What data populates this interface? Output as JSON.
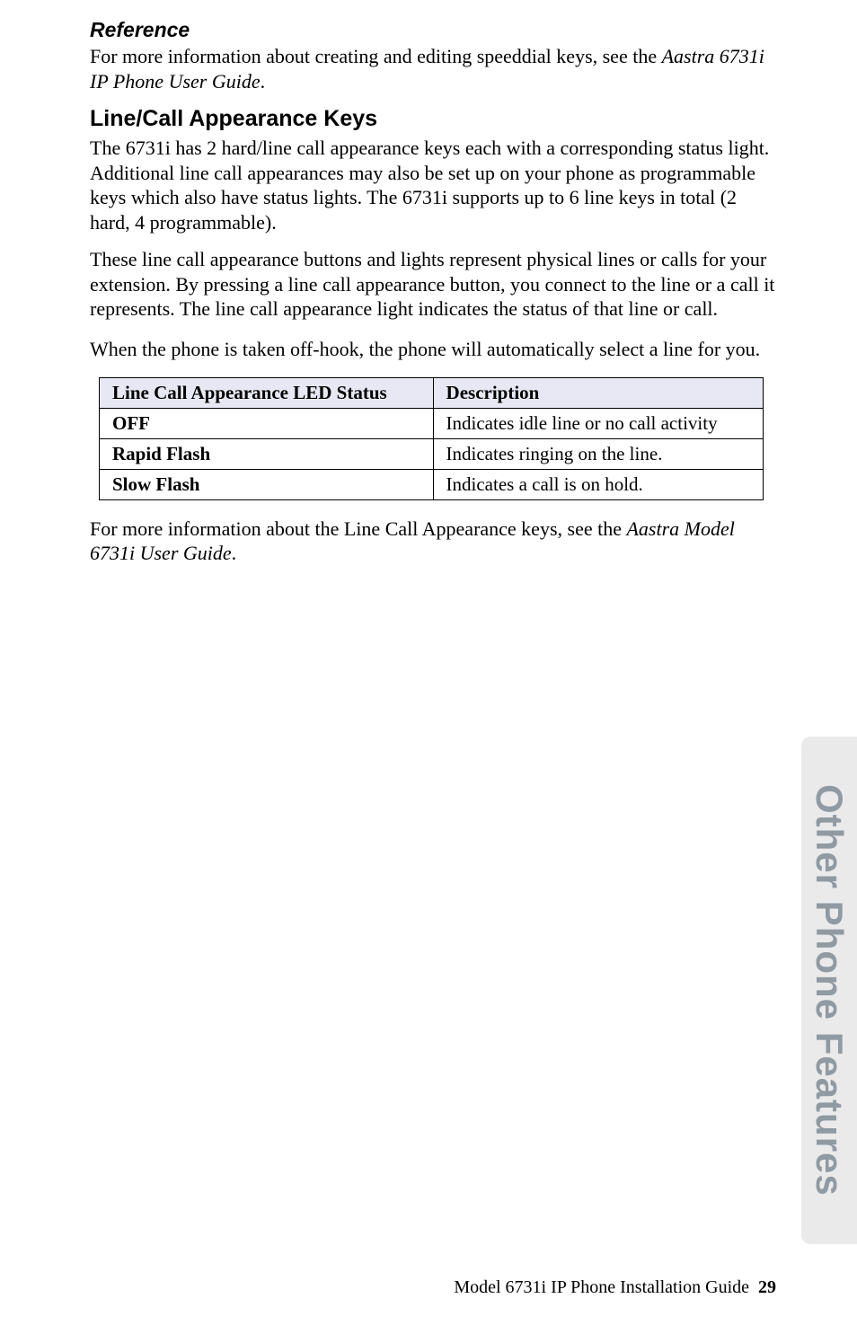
{
  "reference": {
    "heading": "Reference",
    "text_pre": "For more information about creating and editing speeddial keys, see the ",
    "text_em": "Aastra 6731i IP Phone User Guide",
    "text_post": "."
  },
  "section": {
    "heading": "Line/Call Appearance Keys",
    "p1": "The 6731i has 2 hard/line call appearance keys each with a corresponding status light. Additional line call appearances may also be set up on your phone as programmable keys which also have status lights. The 6731i supports up to 6 line keys in total (2 hard, 4 programmable).",
    "p2": "These line call appearance buttons and lights represent physical lines or calls for your extension. By pressing a line call appearance button, you connect to the line or a call it represents. The line call appearance light indicates the status of that line or call.",
    "p3": "When the phone is taken off-hook, the phone will automatically select a line for you."
  },
  "table": {
    "head_left": "Line Call Appearance LED Status",
    "head_right": "Description",
    "rows": [
      {
        "label": "OFF",
        "desc": "Indicates idle line or no call activity"
      },
      {
        "label": "Rapid Flash",
        "desc": "Indicates ringing on the line."
      },
      {
        "label": "Slow Flash",
        "desc": "Indicates a call is on hold."
      }
    ]
  },
  "after_table": {
    "pre": "For more information about the Line Call Appearance keys, see the ",
    "em": "Aastra Model 6731i User Guide",
    "post": "."
  },
  "side_tab": "Other Phone Features",
  "footer": {
    "text": "Model 6731i IP Phone Installation Guide",
    "page": "29"
  }
}
